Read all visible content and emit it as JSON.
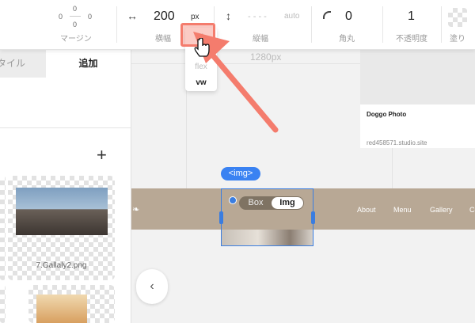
{
  "toolbar": {
    "margin": {
      "top": "0",
      "left": "0",
      "right": "0",
      "bottom": "0",
      "label": "マージン"
    },
    "width": {
      "icon": "↔",
      "value": "200",
      "unit": "px",
      "label": "横幅"
    },
    "height": {
      "icon": "↕",
      "value": "- - - -",
      "unit": "auto",
      "label": "縦幅"
    },
    "radius": {
      "value": "0",
      "label": "角丸"
    },
    "opacity": {
      "value": "1",
      "label": "不透明度"
    },
    "fill": {
      "label": "塗り"
    }
  },
  "unit_dropdown": {
    "items": [
      "%",
      "px",
      "flex",
      "vw"
    ],
    "selected": "vw"
  },
  "canvas": {
    "breakpoint_label": "1280px",
    "card": {
      "title": "Doggo Photo",
      "subtitle": "red458571.studio.site"
    },
    "nav_links": [
      "About",
      "Menu",
      "Gallery",
      "Co"
    ],
    "selection_tag": "<img>",
    "toggle": {
      "box": "Box",
      "img": "Img"
    }
  },
  "left_panel": {
    "tabs": {
      "style": "タイル",
      "add": "追加"
    },
    "add_icon": "+",
    "assets": [
      {
        "label": "7.Gallaly2.png"
      }
    ],
    "collapse_icon": "‹"
  },
  "colors": {
    "accent": "#3a82f2",
    "highlight": "#f47c6d",
    "nav_bg": "#b8a895"
  }
}
